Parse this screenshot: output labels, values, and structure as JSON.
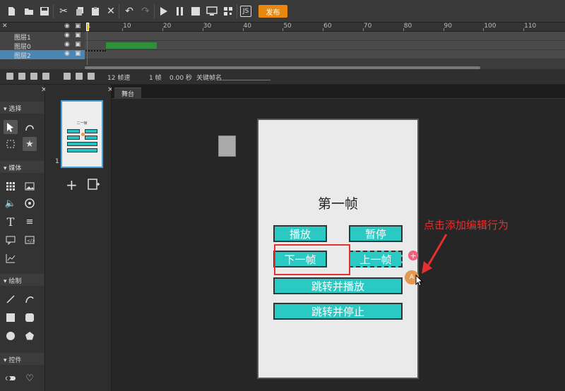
{
  "toolbar": {
    "publish_label": "发布",
    "js_label": "JS",
    "icons": [
      "new-file-icon",
      "open-folder-icon",
      "save-icon",
      "cut-icon",
      "copy-icon",
      "paste-icon",
      "delete-icon",
      "undo-icon",
      "redo-icon",
      "play-icon",
      "pause-icon",
      "stop-icon",
      "preview-icon",
      "qr-code-icon",
      "js-icon"
    ]
  },
  "timeline": {
    "ruler_ticks": [
      "1",
      "10",
      "20",
      "30",
      "40",
      "50",
      "60",
      "70",
      "80",
      "90",
      "100",
      "110"
    ],
    "layers": [
      {
        "name": "图层1"
      },
      {
        "name": "图层0"
      },
      {
        "name": "图层2"
      }
    ]
  },
  "timeline_bar": {
    "fps": "12 帧速",
    "frame": "1 帧",
    "time": "0.00 秒",
    "keyframe_label": "关键帧名"
  },
  "tools": {
    "sections": {
      "select": "选择",
      "media": "媒体",
      "draw": "绘制",
      "controls": "控件"
    }
  },
  "pages": {
    "page_number": "1",
    "thumb_title": "二一帧"
  },
  "stage": {
    "tab_label": "舞台",
    "frame_title": "第一帧",
    "buttons": {
      "play": "播放",
      "pause": "暂停",
      "next": "下一帧",
      "prev": "上一帧",
      "goto_play": "跳转并播放",
      "goto_stop": "跳转并停止"
    },
    "badge_plus": "+",
    "badge_action": "A"
  },
  "annotation": {
    "text": "点击添加编辑行为",
    "color": "#e53030"
  },
  "colors": {
    "accent_button": "#2ac9c4",
    "publish": "#e8880e",
    "selection": "#4aa3d8"
  }
}
